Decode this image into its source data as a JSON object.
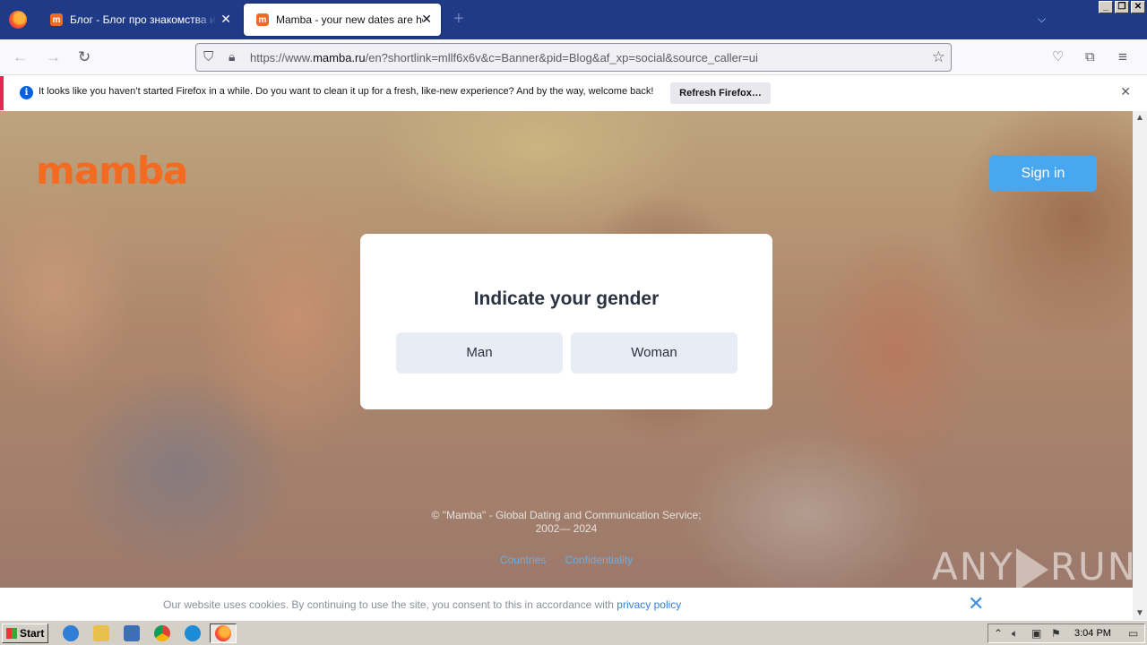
{
  "browser": {
    "tabs": [
      {
        "title": "Блог - Блог про знакомства и отношения",
        "active": false,
        "favicon": "mamba-favicon"
      },
      {
        "title": "Mamba - your new dates are here",
        "active": true,
        "favicon": "mamba-favicon"
      }
    ],
    "url_prefix": "https://www.",
    "url_domain": "mamba.ru",
    "url_rest": "/en?shortlink=mllf6x6v&c=Banner&pid=Blog&af_xp=social&source_caller=ui"
  },
  "notification": {
    "message": "It looks like you haven’t started Firefox in a while. Do you want to clean it up for a fresh, like-new experience? And by the way, welcome back!",
    "button_label": "Refresh Firefox…"
  },
  "site": {
    "logo": "mamba",
    "signin_label": "Sign in",
    "modal": {
      "heading": "Indicate your gender",
      "options": [
        "Man",
        "Woman"
      ]
    },
    "footer": {
      "copyright_line1": "© \"Mamba\" - Global Dating and Communication Service;",
      "copyright_line2": "2002— 2024",
      "links": [
        "Countries",
        "Confidentiality"
      ]
    },
    "cookie": {
      "text": "Our website uses cookies. By continuing to use the site, you consent to this in accordance with ",
      "link": "privacy policy"
    }
  },
  "watermark": {
    "left": "ANY",
    "right": "RUN"
  },
  "taskbar": {
    "start_label": "Start",
    "time": "3:04 PM"
  },
  "colors": {
    "brand_orange": "#f36b21",
    "signin_blue": "#48a7ef",
    "tabstrip": "#1f3a86"
  }
}
